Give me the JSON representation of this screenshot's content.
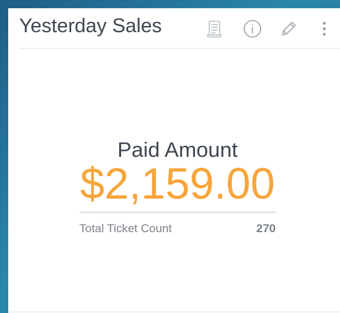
{
  "widget": {
    "title": "Yesterday Sales",
    "toolbar": {
      "report_icon": "report-scroll-icon",
      "info_icon": "info-icon",
      "edit_icon": "pencil-icon",
      "more_icon": "more-vertical-icon"
    }
  },
  "kpi": {
    "label": "Paid Amount",
    "value": "$2,159.00",
    "secondary_label": "Total Ticket Count",
    "secondary_value": "270"
  },
  "colors": {
    "accent": "#f7a43a",
    "text": "#3f4652",
    "muted": "#7b8088",
    "background": "#2b87ab"
  }
}
